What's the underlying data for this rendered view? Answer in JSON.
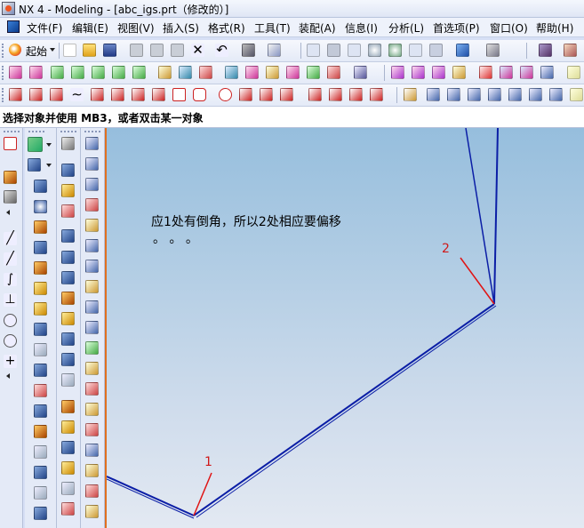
{
  "window": {
    "title": "NX 4 - Modeling - [abc_igs.prt（修改的）]"
  },
  "menu": {
    "items": [
      "文件(F)",
      "编辑(E)",
      "视图(V)",
      "插入(S)",
      "格式(R)",
      "工具(T)",
      "装配(A)",
      "信息(I)",
      "分析(L)",
      "首选项(P)",
      "窗口(O)",
      "帮助(H)"
    ]
  },
  "toolbar": {
    "start_label": "起始"
  },
  "cue_line": {
    "text": "选择对象并使用 MB3，或者双击某一对象"
  },
  "graphics": {
    "annotation_line1": "应1处有倒角，所以2处相应要偏移",
    "annotation_line2": "。 。 。",
    "label_1": "1",
    "label_2": "2",
    "wire_color": "#0b1ea6",
    "marker_color": "#e01414"
  },
  "colors": {
    "accent": "#e07020",
    "background_top": "#96bedd",
    "background_bottom": "#e3e9f2"
  }
}
